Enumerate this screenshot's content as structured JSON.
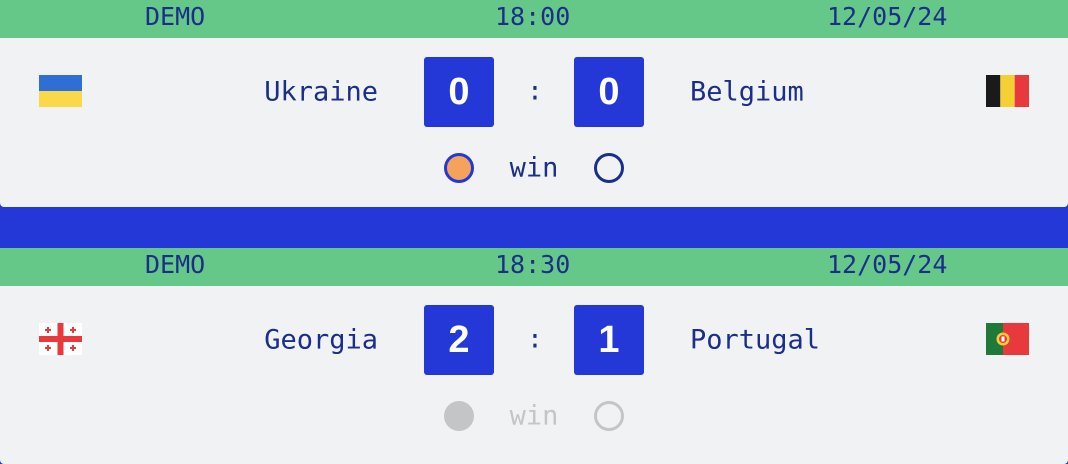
{
  "colors": {
    "header_bg": "#66c888",
    "score_bg": "#2338d6",
    "page_bg": "#2338d6",
    "selected_radio": "#f5a25d",
    "disabled": "#c4c5c7",
    "text": "#1a2f8a"
  },
  "matches": [
    {
      "header": {
        "left": "DEMO",
        "time": "18:00",
        "date": "12/05/24"
      },
      "home": {
        "name": "Ukraine",
        "flag_icon": "ukraine-flag-icon",
        "score": "0"
      },
      "away": {
        "name": "Belgium",
        "flag_icon": "belgium-flag-icon",
        "score": "0"
      },
      "separator": ":",
      "pick_label": "win",
      "pick": "home",
      "pick_enabled": true
    },
    {
      "header": {
        "left": "DEMO",
        "time": "18:30",
        "date": "12/05/24"
      },
      "home": {
        "name": "Georgia",
        "flag_icon": "georgia-flag-icon",
        "score": "2"
      },
      "away": {
        "name": "Portugal",
        "flag_icon": "portugal-flag-icon",
        "score": "1"
      },
      "separator": ":",
      "pick_label": "win",
      "pick": "home",
      "pick_enabled": false
    }
  ]
}
